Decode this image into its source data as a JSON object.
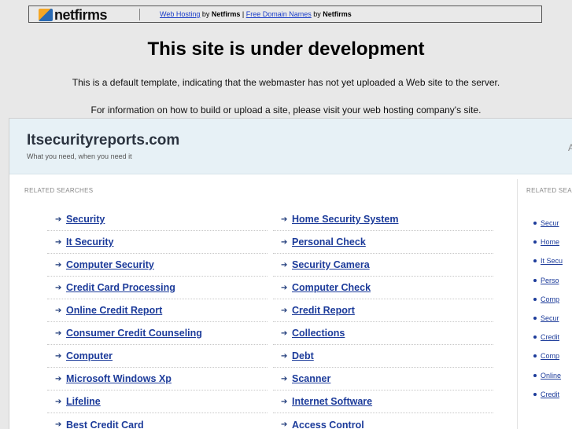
{
  "banner": {
    "logo_text": "netfirms",
    "link1": "Web Hosting",
    "by1": " by ",
    "brand1": "Netfirms",
    "sep": " | ",
    "link2": "Free Domain Names",
    "by2": " by ",
    "brand2": "Netfirms"
  },
  "notice": {
    "title": "This site is under development",
    "line1": "This is a default template, indicating that the webmaster has not yet uploaded a Web site to the server.",
    "line2": "For information on how to build or upload a site, please visit your web hosting company's site."
  },
  "site": {
    "name": "Itsecurityreports.com",
    "tagline": "What you need, when you need it",
    "edge_char": "A"
  },
  "related": {
    "label": "RELATED SEARCHES",
    "right_label": "RELATED SEA",
    "left_col": [
      "Security",
      "It Security",
      "Computer Security",
      "Credit Card Processing",
      "Online Credit Report",
      "Consumer Credit Counseling",
      "Computer",
      "Microsoft Windows Xp",
      "Lifeline",
      "Best Credit Card"
    ],
    "right_col": [
      "Home Security System",
      "Personal Check",
      "Security Camera",
      "Computer Check",
      "Credit Report",
      "Collections",
      "Debt",
      "Scanner",
      "Internet Software",
      "Access Control"
    ],
    "side_col": [
      "Secur",
      "Home",
      "It Secu",
      "Perso",
      "Comp",
      "Secur",
      "Credit",
      "Comp",
      "Online",
      "Credit"
    ]
  },
  "colors": {
    "link": "#1c3b9a",
    "header_bg": "#e7f1f6",
    "page_bg": "#e8e8e8"
  },
  "icons": {
    "row_arrow": "arrow-right-icon",
    "side_bullet": "bullet-icon"
  }
}
